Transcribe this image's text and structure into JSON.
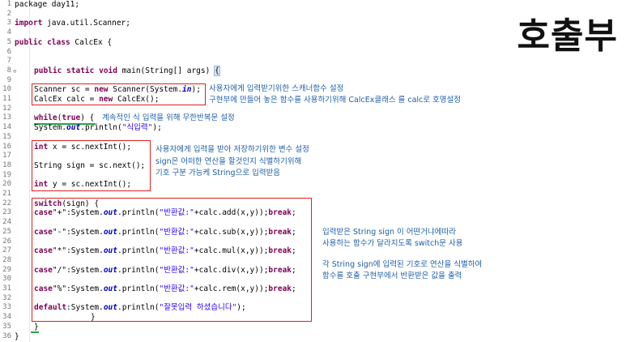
{
  "title": "호출부",
  "line_numbers": [
    "1",
    "2",
    "3",
    "4",
    "5",
    "6",
    "7",
    "8",
    "9",
    "10",
    "11",
    "12",
    "13",
    "14",
    "15",
    "16",
    "17",
    "18",
    "19",
    "20",
    "21",
    "22",
    "23",
    "24",
    "25",
    "26",
    "27",
    "28",
    "29",
    "30",
    "31",
    "32",
    "33",
    "34",
    "35",
    "36"
  ],
  "code": {
    "l1": "package day11;",
    "l3_kw": "import",
    "l3_rest": " java.util.Scanner;",
    "l5_kw1": "public",
    "l5_kw2": "class",
    "l5_rest": " CalcEx {",
    "l8_kw": "public static void",
    "l8_rest": " main(String[] args) ",
    "l8_brace": "{",
    "l10_a": "Scanner sc = ",
    "l10_kw": "new",
    "l10_b": " Scanner(System.",
    "l10_fld": "in",
    "l10_c": ");",
    "l11_a": "CalcEx calc = ",
    "l11_kw": "new",
    "l11_b": " CalcEx();",
    "l13_kw": "while",
    "l13_par": "(",
    "l13_kw2": "true",
    "l13_rest": ") {",
    "l14_a": "System.",
    "l14_fld": "out",
    "l14_b": ".println(",
    "l14_str": "\"식입력\"",
    "l14_c": ");",
    "l16_kw": "int",
    "l16_rest": " x = sc.nextInt();",
    "l18": "String sign = sc.next();",
    "l20_kw": "int",
    "l20_rest": " y = sc.nextInt();",
    "l22_kw": "switch",
    "l22_rest": "(sign) {",
    "cases": [
      {
        "op": "\"+\"",
        "fn": "add"
      },
      {
        "op": "\"-\"",
        "fn": "sub"
      },
      {
        "op": "\"*\"",
        "fn": "mul"
      },
      {
        "op": "\"/\"",
        "fn": "div"
      },
      {
        "op": "\"%\"",
        "fn": "rem"
      }
    ],
    "case_kw": "case",
    "case_sys": ":System.",
    "case_out": "out",
    "case_print": ".println(",
    "case_str": "\"반환값:\"",
    "case_calc": "+calc.",
    "case_args": "(x,y));",
    "break_kw": "break",
    "semi": ";",
    "default_kw": "default",
    "default_str": "\"잘못입력 하셨습니다\"",
    "default_c": ");",
    "close1": "}",
    "close2": "}",
    "close3": "}"
  },
  "notes": {
    "n1": "사용자에게 입력받기위한 스캐너함수 설정",
    "n2": "구현부에 만들어 놓은 함수를 사용하기위해 CalcEx클래스 를 calc로 호명설정",
    "n3": "계속적인 식 입력을 위해 무한반복문 설정",
    "n4": "사용자에게 입력을 받아 저장하기위한 변수 설정",
    "n5": "sign은 어떠한 연산을 할것인지 식별하기위해",
    "n6": "기호 구분 가능케 String으로 입력받음",
    "n7": "입력받은 String sign 이 어떤거냐에따라",
    "n8": "사용하는 함수가 달라지도록 switch문 사용",
    "n9": "각 String sign에 입력된 기호로 연산을 식별하여",
    "n10": "함수를 호출 구현부에서 반환받은 값을 출력"
  },
  "colors": {
    "keyword": "#7f0055",
    "string": "#2a00ff",
    "field": "#0000c0",
    "annotation": "#1f5fa8",
    "box": "#e02020"
  }
}
